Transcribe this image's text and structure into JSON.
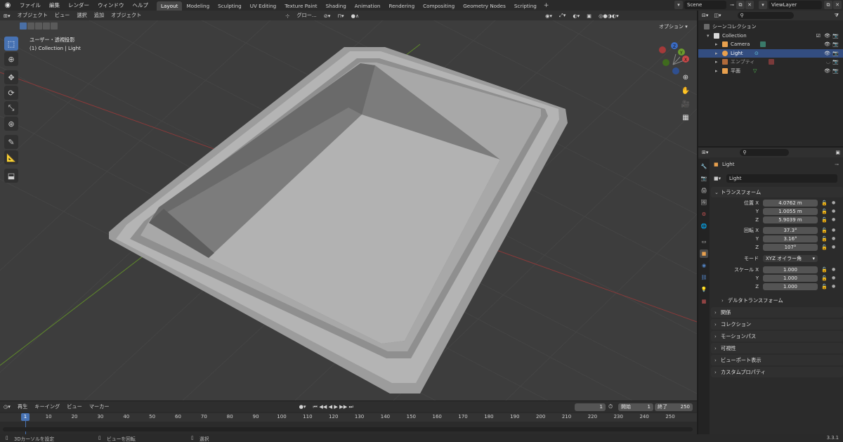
{
  "topbar": {
    "menus": [
      "ファイル",
      "編集",
      "レンダー",
      "ウィンドウ",
      "ヘルプ"
    ],
    "workspace_tabs": [
      "Layout",
      "Modeling",
      "Sculpting",
      "UV Editing",
      "Texture Paint",
      "Shading",
      "Animation",
      "Rendering",
      "Compositing",
      "Geometry Nodes",
      "Scripting"
    ],
    "active_tab": "Layout",
    "scene": "Scene",
    "view_layer": "ViewLayer"
  },
  "viewport": {
    "mode": "オブジェクト",
    "menus": [
      "ビュー",
      "選択",
      "追加",
      "オブジェクト"
    ],
    "transform_orientation": "グロー...",
    "options_label": "オプション",
    "view_name": "ユーザー・透視投影",
    "view_context": "(1) Collection | Light"
  },
  "timeline": {
    "menus": [
      "再生",
      "キーイング",
      "ビュー",
      "マーカー"
    ],
    "current_frame": "1",
    "start_label": "開始",
    "start_value": "1",
    "end_label": "終了",
    "end_value": "250",
    "ticks": [
      "1",
      "10",
      "20",
      "30",
      "40",
      "50",
      "60",
      "70",
      "80",
      "90",
      "100",
      "110",
      "120",
      "130",
      "140",
      "150",
      "160",
      "170",
      "180",
      "190",
      "200",
      "210",
      "220",
      "230",
      "240",
      "250"
    ]
  },
  "statusbar": {
    "hint1": "3Dカーソルを設定",
    "hint2": "ビューを回転",
    "hint3": "選択",
    "version": "3.3.1"
  },
  "outliner": {
    "scene_collection": "シーンコレクション",
    "items": [
      {
        "label": "Collection",
        "color": "#e0e0e0"
      },
      {
        "label": "Camera",
        "color": "#e8a04e"
      },
      {
        "label": "Light",
        "color": "#e8a04e"
      },
      {
        "label": "エンプティ",
        "color": "#a0a0a0"
      },
      {
        "label": "平面",
        "color": "#e8a04e"
      }
    ]
  },
  "properties": {
    "object_name": "Light",
    "object_field": "Light",
    "transform_title": "トランスフォーム",
    "location_label": "位置 X",
    "location": [
      "4.0762 m",
      "1.0055 m",
      "5.9039 m"
    ],
    "rotation_label": "回転 X",
    "rotation": [
      "37.3°",
      "3.16°",
      "107°"
    ],
    "mode_label": "モード",
    "mode_value": "XYZ オイラー角",
    "scale_label": "スケール X",
    "scale": [
      "1.000",
      "1.000",
      "1.000"
    ],
    "y_label": "Y",
    "z_label": "Z",
    "delta_transform": "デルタトランスフォーム",
    "panels": [
      "関係",
      "コレクション",
      "モーションパス",
      "可視性",
      "ビューポート表示",
      "カスタムプロパティ"
    ]
  },
  "colors": {
    "accent": "#4772b3",
    "viewport_bg": "#3d3d3d",
    "selection": "#334d80"
  }
}
